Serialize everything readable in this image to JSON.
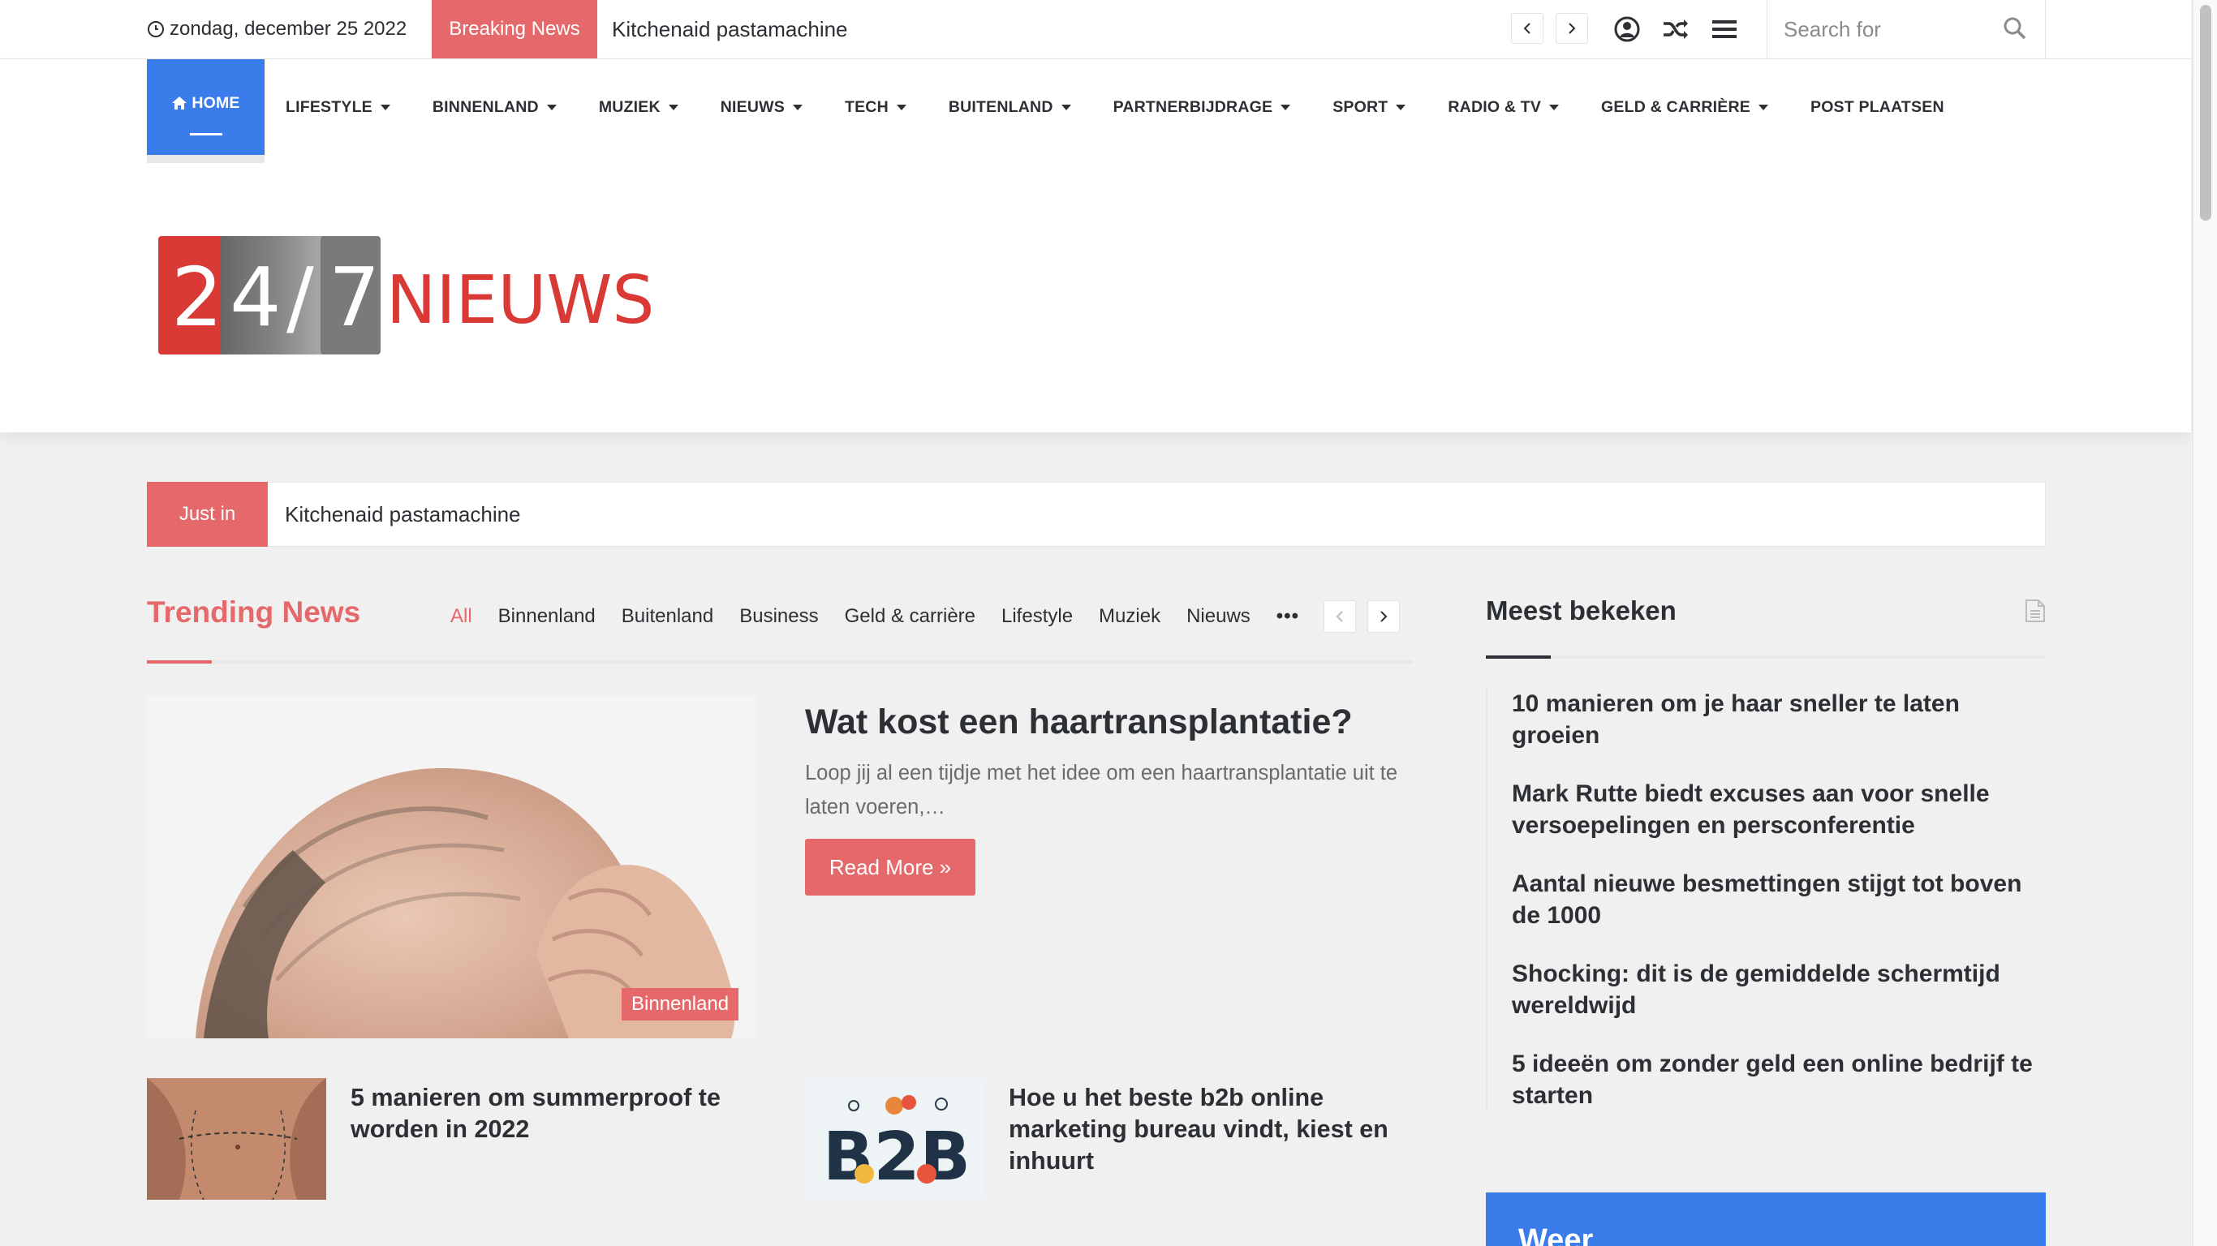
{
  "topbar": {
    "date": "zondag, december 25 2022",
    "breaking_label": "Breaking News",
    "breaking_text": "Kitchenaid pastamachine",
    "search_placeholder": "Search for"
  },
  "nav": {
    "home": "HOME",
    "items": [
      {
        "label": "LIFESTYLE",
        "has_dropdown": true
      },
      {
        "label": "BINNENLAND",
        "has_dropdown": true
      },
      {
        "label": "MUZIEK",
        "has_dropdown": true
      },
      {
        "label": "NIEUWS",
        "has_dropdown": true
      },
      {
        "label": "TECH",
        "has_dropdown": true
      },
      {
        "label": "BUITENLAND",
        "has_dropdown": true
      },
      {
        "label": "PARTNERBIJDRAGE",
        "has_dropdown": true
      },
      {
        "label": "SPORT",
        "has_dropdown": true
      },
      {
        "label": "RADIO & TV",
        "has_dropdown": true
      },
      {
        "label": "GELD & CARRIÈRE",
        "has_dropdown": true
      },
      {
        "label": "POST PLAATSEN",
        "has_dropdown": false
      }
    ]
  },
  "logo": {
    "digits": [
      "2",
      "4",
      "/",
      "7"
    ],
    "word": "NIEUWS"
  },
  "justin": {
    "label": "Just in",
    "text": "Kitchenaid pastamachine"
  },
  "trending": {
    "title": "Trending News",
    "tabs": [
      "All",
      "Binnenland",
      "Buitenland",
      "Business",
      "Geld & carrière",
      "Lifestyle",
      "Muziek",
      "Nieuws"
    ],
    "more": "•••",
    "main_article": {
      "category": "Binnenland",
      "title": "Wat kost een haartransplantatie?",
      "excerpt": "Loop jij al een tijdje met het idee om een haartransplantatie uit te laten voeren,…",
      "read_more": "Read More »"
    },
    "small_articles": [
      {
        "title": "5 manieren om summerproof te worden in 2022"
      },
      {
        "title": "Hoe u het beste b2b online marketing bureau vindt, kiest en inhuurt"
      }
    ],
    "b2b_text": "B2B"
  },
  "sidebar": {
    "title": "Meest bekeken",
    "items": [
      "10 manieren om je haar sneller te laten groeien",
      "Mark Rutte biedt excuses aan voor snelle versoepelingen en persconferentie",
      "Aantal nieuwe besmettingen stijgt tot boven de 1000",
      "Shocking: dit is de gemiddelde schermtijd wereldwijd",
      "5 ideeën om zonder geld een online bedrijf te starten"
    ],
    "weer_title": "Weer"
  },
  "colors": {
    "accent": "#e5686b",
    "nav_blue": "#3a7ce9",
    "text": "#2c2f34"
  }
}
